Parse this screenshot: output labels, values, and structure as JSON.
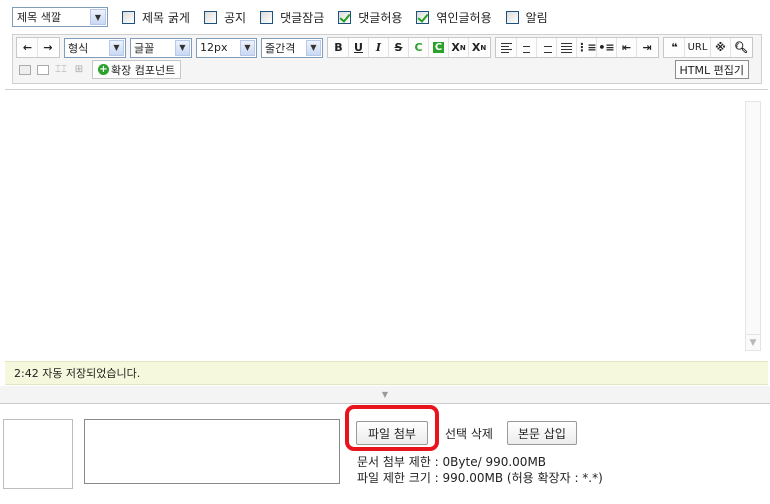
{
  "title_options": {
    "color_select": "제목 색깔",
    "bold_label": "제목 굵게",
    "notice_label": "공지",
    "lock_comments_label": "댓글잠금",
    "allow_comments_label": "댓글허용",
    "allow_trackback_label": "엮인글허용",
    "alert_label": "알림",
    "checked": {
      "bold": false,
      "notice": false,
      "lock_comments": false,
      "allow_comments": true,
      "allow_trackback": true,
      "alert": false
    }
  },
  "toolbar": {
    "format_select": "형식",
    "font_select": "글꼴",
    "size_select": "12px",
    "line_height_select": "줄간격",
    "bold": "B",
    "underline": "U",
    "italic": "I",
    "strike": "S",
    "font_color": "C",
    "bg_color": "C",
    "superscript": "X",
    "subscript": "X",
    "url": "URL",
    "extension_button": "확장 컴포넌트",
    "html_editor_button": "HTML 편집기"
  },
  "status": {
    "autosave_message": "2:42 자동 저장되었습니다."
  },
  "file_upload": {
    "attach_button": "파일 첨부",
    "delete_button": "선택 삭제",
    "insert_button": "본문 삽입",
    "doc_limit_text": "문서 첨부 제한 : 0Byte/ 990.00MB",
    "file_limit_text": "파일 제한 크기 : 990.00MB (허용 확장자 : *.*)"
  },
  "colors": {
    "highlight": "#e8131c",
    "status_bg": "#f6f8dd",
    "check_green": "#21a121"
  }
}
